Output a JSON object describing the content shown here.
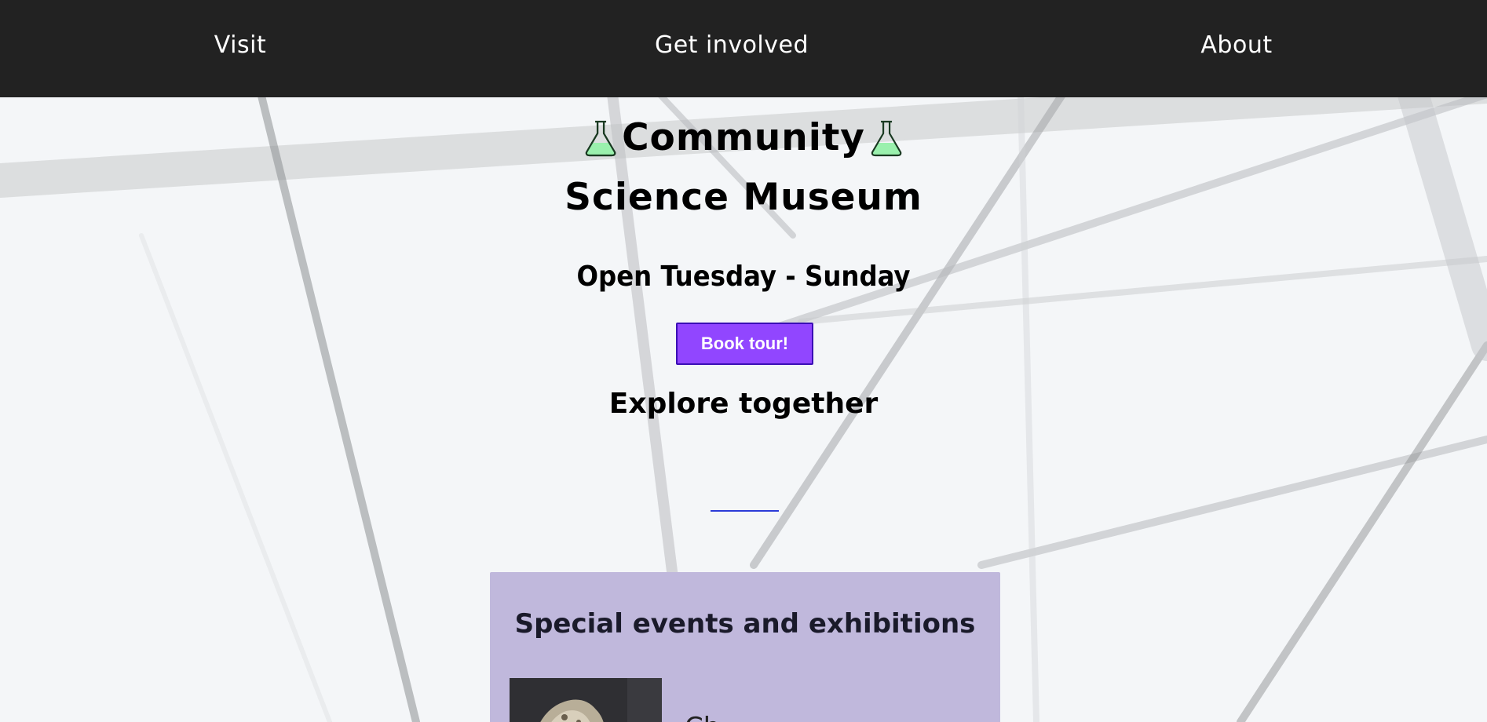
{
  "nav": {
    "items": [
      {
        "label": "Visit"
      },
      {
        "label": "Get involved"
      },
      {
        "label": "About"
      }
    ]
  },
  "hero": {
    "title_line1": "Community",
    "title_line2": "Science Museum",
    "title_icon": "flask-icon",
    "hours": "Open Tuesday - Sunday",
    "book_button": "Book tour!",
    "tagline": "Explore together"
  },
  "events": {
    "title": "Special events and exhibitions",
    "first_item_partial_text": "Ch...",
    "photo_icon": "exhibit-photo"
  },
  "colors": {
    "nav_bg": "#222222",
    "accent": "#9146ff",
    "panel_bg": "#c0b8dc",
    "flask_liquid": "#9af0ad"
  }
}
